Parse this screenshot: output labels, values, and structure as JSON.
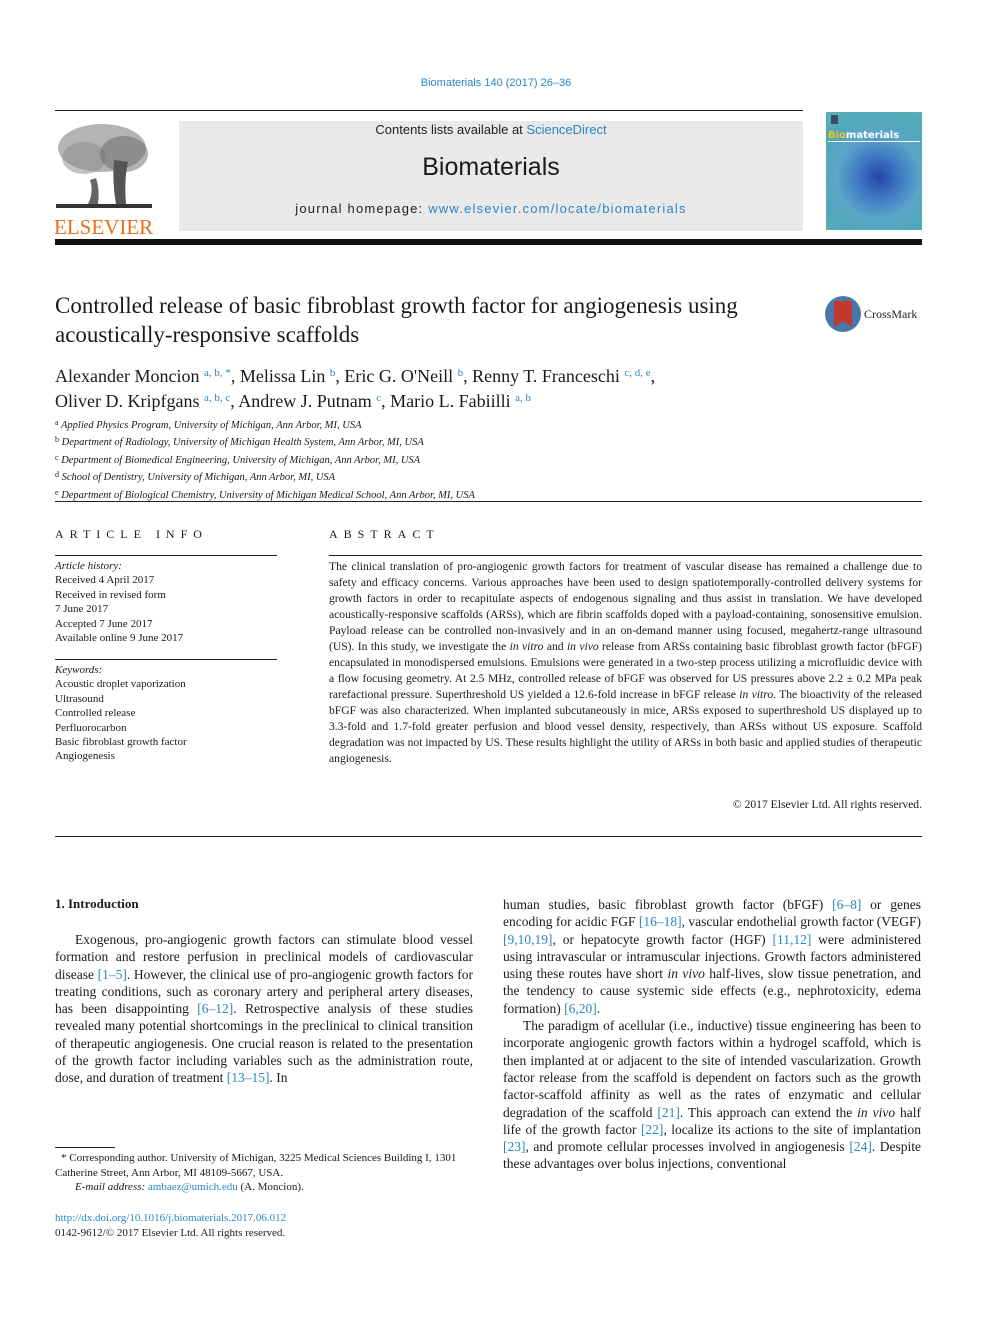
{
  "header": {
    "journal_ref": "Biomaterials 140 (2017) 26–36",
    "contents_prefix": "Contents lists available at ",
    "contents_link": "ScienceDirect",
    "journal_title": "Biomaterials",
    "homepage_prefix": "journal homepage: ",
    "homepage_link": "www.elsevier.com/locate/biomaterials",
    "publisher_logo_text": "ELSEVIER",
    "cover_title_highlight": "Bio",
    "cover_title_rest": "materials",
    "crossmark_label": "CrossMark"
  },
  "article": {
    "title": "Controlled release of basic fibroblast growth factor for angiogenesis using acoustically-responsive scaffolds",
    "authors": [
      {
        "name": "Alexander Moncion",
        "aff": "a, b, *"
      },
      {
        "name": "Melissa Lin",
        "aff": "b"
      },
      {
        "name": "Eric G. O'Neill",
        "aff": "b"
      },
      {
        "name": "Renny T. Franceschi",
        "aff": "c, d, e"
      },
      {
        "name": "Oliver D. Kripfgans",
        "aff": "a, b, c"
      },
      {
        "name": "Andrew J. Putnam",
        "aff": "c"
      },
      {
        "name": "Mario L. Fabiilli",
        "aff": "a, b"
      }
    ],
    "affiliations": [
      {
        "key": "a",
        "text": "Applied Physics Program, University of Michigan, Ann Arbor, MI, USA"
      },
      {
        "key": "b",
        "text": "Department of Radiology, University of Michigan Health System, Ann Arbor, MI, USA"
      },
      {
        "key": "c",
        "text": "Department of Biomedical Engineering, University of Michigan, Ann Arbor, MI, USA"
      },
      {
        "key": "d",
        "text": "School of Dentistry, University of Michigan, Ann Arbor, MI, USA"
      },
      {
        "key": "e",
        "text": "Department of Biological Chemistry, University of Michigan Medical School, Ann Arbor, MI, USA"
      }
    ]
  },
  "article_info": {
    "heading": "ARTICLE INFO",
    "history_label": "Article history:",
    "history": [
      "Received 4 April 2017",
      "Received in revised form",
      "7 June 2017",
      "Accepted 7 June 2017",
      "Available online 9 June 2017"
    ],
    "keywords_label": "Keywords:",
    "keywords": [
      "Acoustic droplet vaporization",
      "Ultrasound",
      "Controlled release",
      "Perfluorocarbon",
      "Basic fibroblast growth factor",
      "Angiogenesis"
    ]
  },
  "abstract": {
    "heading": "ABSTRACT",
    "p1": "The clinical translation of pro-angiogenic growth factors for treatment of vascular disease has remained a challenge due to safety and efficacy concerns. Various approaches have been used to design spatiotemporally-controlled delivery systems for growth factors in order to recapitulate aspects of endogenous signaling and thus assist in translation. We have developed acoustically-responsive scaffolds (ARSs), which are fibrin scaffolds doped with a payload-containing, sonosensitive emulsion. Payload release can be controlled non-invasively and in an on-demand manner using focused, megahertz-range ultrasound (US). In this study, we investigate the ",
    "i1": "in vitro",
    "p2": " and ",
    "i2": "in vivo",
    "p3": " release from ARSs containing basic fibroblast growth factor (bFGF) encapsulated in monodispersed emulsions. Emulsions were generated in a two-step process utilizing a microfluidic device with a flow focusing geometry. At 2.5 MHz, controlled release of bFGF was observed for US pressures above 2.2 ± 0.2 MPa peak rarefactional pressure. Superthreshold US yielded a 12.6-fold increase in bFGF release ",
    "i3": "in vitro",
    "p4": ". The bioactivity of the released bFGF was also characterized. When implanted subcutaneously in mice, ARSs exposed to superthreshold US displayed up to 3.3-fold and 1.7-fold greater perfusion and blood vessel density, respectively, than ARSs without US exposure. Scaffold degradation was not impacted by US. These results highlight the utility of ARSs in both basic and applied studies of therapeutic angiogenesis.",
    "copyright": "© 2017 Elsevier Ltd. All rights reserved."
  },
  "intro": {
    "heading": "1.  Introduction",
    "left": [
      {
        "t": "Exogenous, pro-angiogenic growth factors can stimulate blood vessel formation and restore perfusion in preclinical models of cardiovascular disease "
      },
      {
        "ref": "[1–5]"
      },
      {
        "t": ". However, the clinical use of pro-angiogenic growth factors for treating conditions, such as coronary artery and peripheral artery diseases, has been disappointing "
      },
      {
        "ref": "[6–12]"
      },
      {
        "t": ". Retrospective analysis of these studies revealed many potential shortcomings in the preclinical to clinical transition of therapeutic angiogenesis. One crucial reason is related to the presentation of the growth factor including variables such as the administration route, dose, and duration of treatment "
      },
      {
        "ref": "[13–15]"
      },
      {
        "t": ". In"
      }
    ],
    "right_p1": [
      {
        "t": "human studies, basic fibroblast growth factor (bFGF) "
      },
      {
        "ref": "[6–8]"
      },
      {
        "t": " or genes encoding for acidic FGF "
      },
      {
        "ref": "[16–18]"
      },
      {
        "t": ", vascular endothelial growth factor (VEGF) "
      },
      {
        "ref": "[9,10,19]"
      },
      {
        "t": ", or hepatocyte growth factor (HGF) "
      },
      {
        "ref": "[11,12]"
      },
      {
        "t": " were administered using intravascular or intramuscular injections. Growth factors administered using these routes have short "
      },
      {
        "i": "in vivo"
      },
      {
        "t": " half-lives, slow tissue penetration, and the tendency to cause systemic side effects (e.g., nephrotoxicity, edema formation) "
      },
      {
        "ref": "[6,20]"
      },
      {
        "t": "."
      }
    ],
    "right_p2": [
      {
        "t": "The paradigm of acellular (i.e., inductive) tissue engineering has been to incorporate angiogenic growth factors within a hydrogel scaffold, which is then implanted at or adjacent to the site of intended vascularization. Growth factor release from the scaffold is dependent on factors such as the growth factor-scaffold affinity as well as the rates of enzymatic and cellular degradation of the scaffold "
      },
      {
        "ref": "[21]"
      },
      {
        "t": ". This approach can extend the "
      },
      {
        "i": "in vivo"
      },
      {
        "t": " half life of the growth factor "
      },
      {
        "ref": "[22]"
      },
      {
        "t": ", localize its actions to the site of implantation "
      },
      {
        "ref": "[23]"
      },
      {
        "t": ", and promote cellular processes involved in angiogenesis "
      },
      {
        "ref": "[24]"
      },
      {
        "t": ". Despite these advantages over bolus injections, conventional"
      }
    ]
  },
  "footnote": {
    "corresponding": "* Corresponding author. University of Michigan, 3225 Medical Sciences Building I, 1301 Catherine Street, Ann Arbor, MI 48109-5667, USA.",
    "email_label": "E-mail address: ",
    "email": "ambaez@umich.edu",
    "email_suffix": " (A. Moncion).",
    "doi": "http://dx.doi.org/10.1016/j.biomaterials.2017.06.012",
    "issn": "0142-9612/© 2017 Elsevier Ltd. All rights reserved."
  },
  "colors": {
    "link": "#2a86c4",
    "elsevier_orange": "#e8701a",
    "masthead_bg": "#e9e9e9"
  }
}
